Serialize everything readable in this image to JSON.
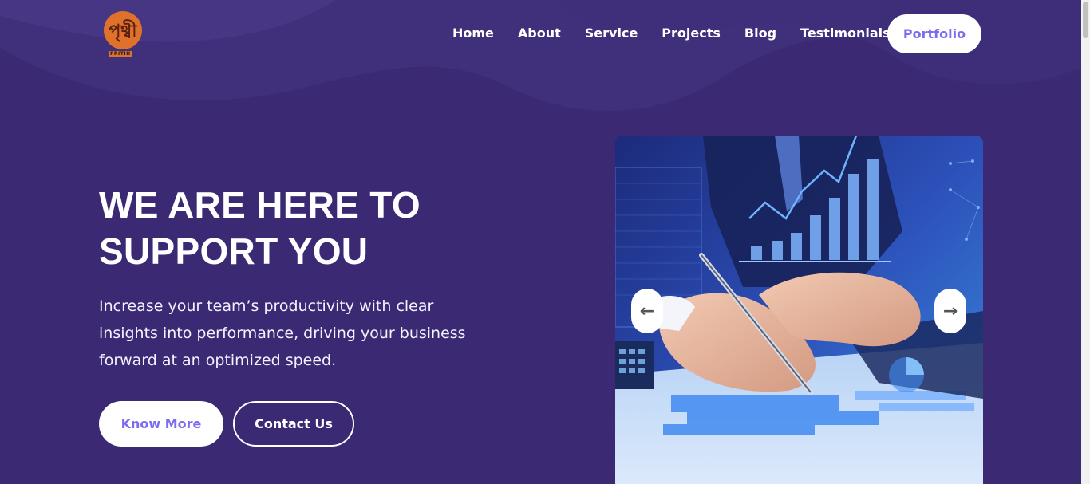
{
  "brand": {
    "logo_text": "পৃথ্বী",
    "logo_subtext": "PRITHI"
  },
  "nav": {
    "items": [
      "Home",
      "About",
      "Service",
      "Projects",
      "Blog",
      "Testimonials"
    ],
    "cta_label": "Portfolio"
  },
  "hero": {
    "title_line1": "WE ARE HERE TO",
    "title_line2": "SUPPORT YOU",
    "description": "Increase your team’s productivity with clear insights into performance, driving your business forward at an optimized speed.",
    "primary_button": "Know More",
    "secondary_button": "Contact Us"
  },
  "slider": {
    "prev_icon": "arrow-left-icon",
    "next_icon": "arrow-right-icon",
    "prev_glyph": "←",
    "next_glyph": "→"
  },
  "colors": {
    "background": "#3b2a73",
    "accent": "#7b6cf0",
    "logo_orange": "#e0712b"
  }
}
